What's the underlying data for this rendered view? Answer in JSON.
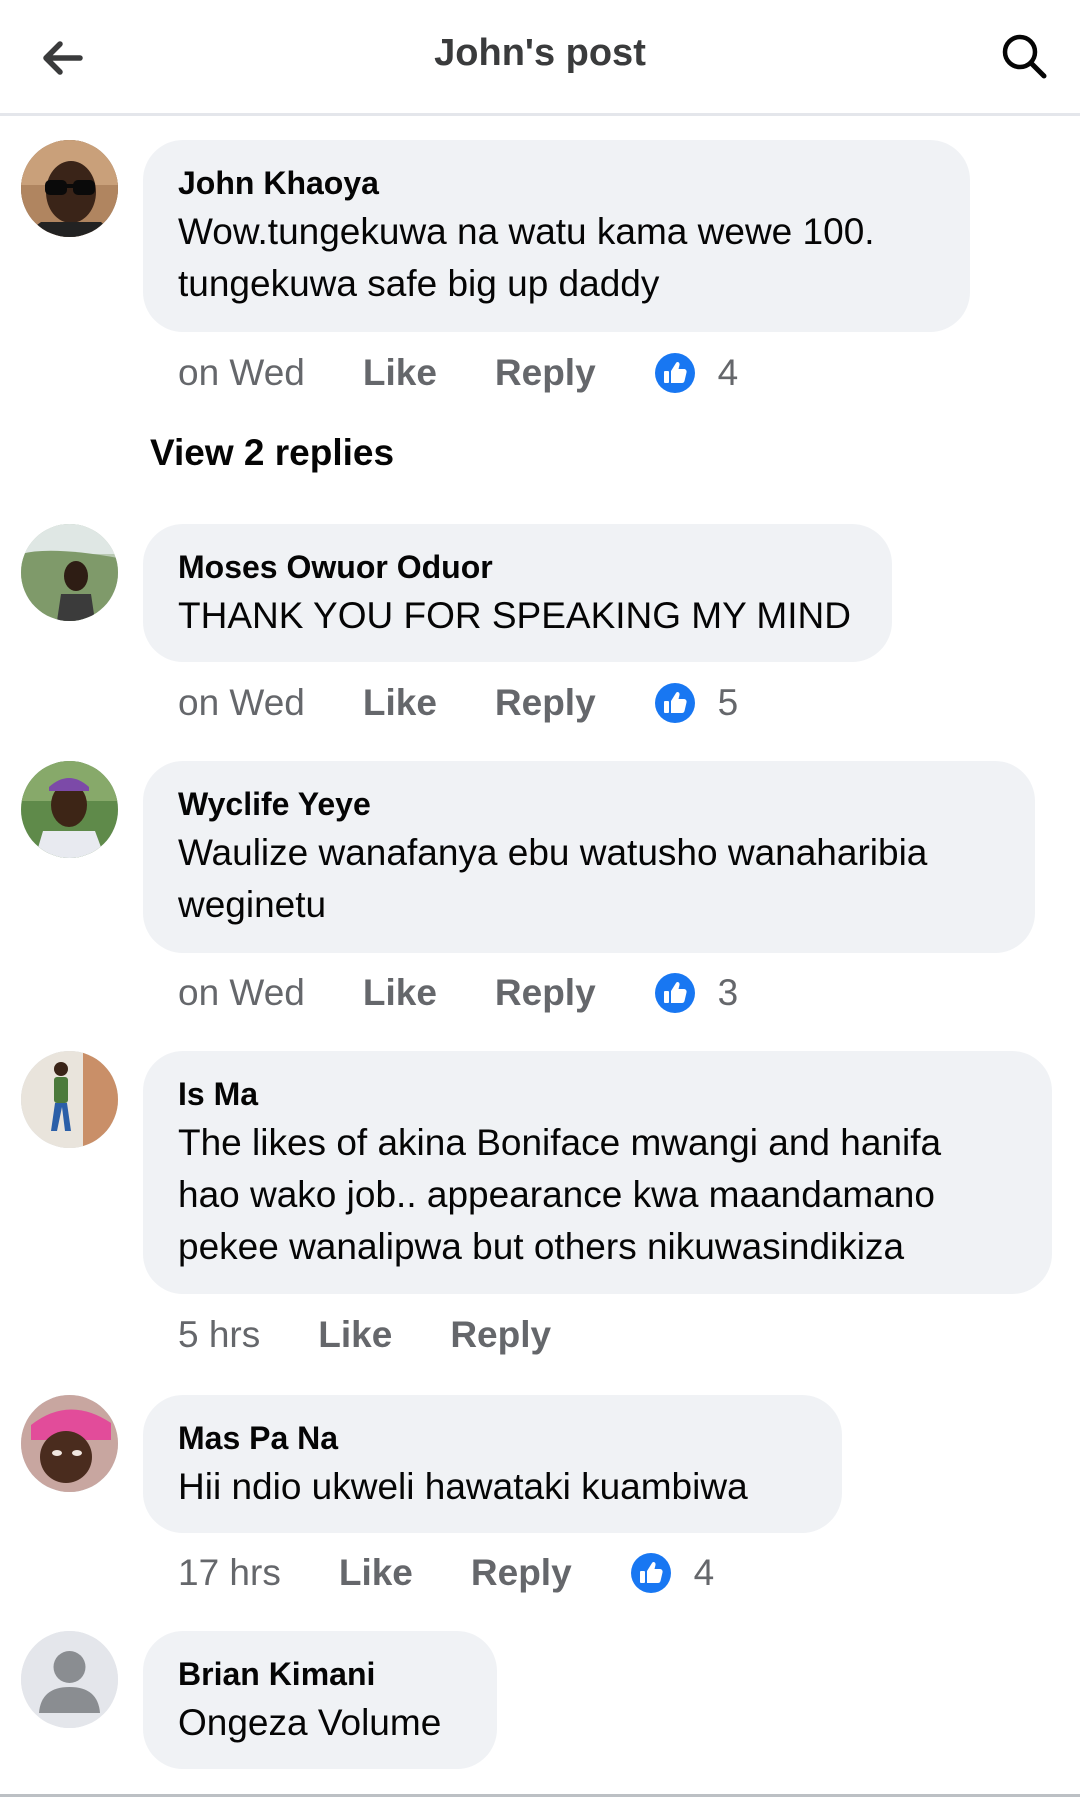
{
  "header": {
    "title": "John's post",
    "back_icon": "arrow-left-icon",
    "search_icon": "search-icon"
  },
  "colors": {
    "like_blue": "#1877f2",
    "meta_gray": "#65676b",
    "bubble_bg": "#f0f2f5"
  },
  "comments": [
    {
      "author": "John Khaoya",
      "text": "Wow.tungekuwa na watu kama wewe 100.\ntungekuwa safe big up daddy",
      "time": "on Wed",
      "like_label": "Like",
      "reply_label": "Reply",
      "reactions": "4"
    },
    {
      "author": "Moses Owuor Oduor",
      "text": "THANK YOU FOR SPEAKING MY MIND",
      "time": "on Wed",
      "like_label": "Like",
      "reply_label": "Reply",
      "reactions": "5"
    },
    {
      "author": "Wyclife Yeye",
      "text": "Waulize wanafanya ebu watusho wanaharibia\nweginetu",
      "time": "on Wed",
      "like_label": "Like",
      "reply_label": "Reply",
      "reactions": "3"
    },
    {
      "author": "Is Ma",
      "text": "The likes of akina Boniface mwangi and hanifa\nhao wako job.. appearance kwa maandamano\npekee wanalipwa but others nikuwasindikiza",
      "time": "5 hrs",
      "like_label": "Like",
      "reply_label": "Reply"
    },
    {
      "author": "Mas Pa Na",
      "text": "Hii ndio ukweli hawataki kuambiwa",
      "time": "17 hrs",
      "like_label": "Like",
      "reply_label": "Reply",
      "reactions": "4"
    },
    {
      "author": "Brian Kimani",
      "text": "Ongeza Volume"
    }
  ],
  "view_replies": "View 2 replies"
}
